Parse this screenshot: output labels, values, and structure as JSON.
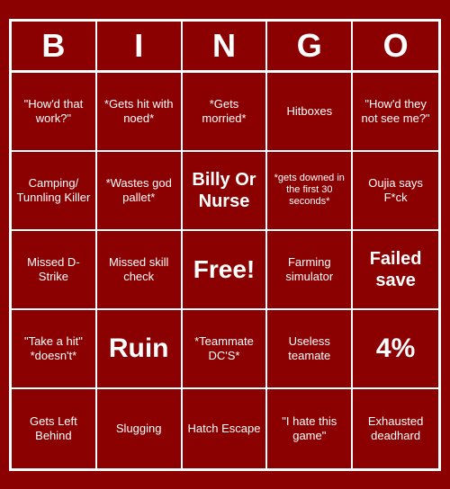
{
  "header": {
    "letters": [
      "B",
      "I",
      "N",
      "G",
      "O"
    ]
  },
  "cells": [
    {
      "text": "\"How'd that work?\"",
      "size": "normal"
    },
    {
      "text": "*Gets hit with noed*",
      "size": "normal"
    },
    {
      "text": "*Gets morried*",
      "size": "normal"
    },
    {
      "text": "Hitboxes",
      "size": "normal"
    },
    {
      "text": "\"How'd they not see me?\"",
      "size": "normal"
    },
    {
      "text": "Camping/ Tunnling Killer",
      "size": "normal"
    },
    {
      "text": "*Wastes god pallet*",
      "size": "normal"
    },
    {
      "text": "Billy Or Nurse",
      "size": "large"
    },
    {
      "text": "*gets downed in the first 30 seconds*",
      "size": "small"
    },
    {
      "text": "Oujia says F*ck",
      "size": "normal"
    },
    {
      "text": "Missed D-Strike",
      "size": "normal"
    },
    {
      "text": "Missed skill check",
      "size": "normal"
    },
    {
      "text": "Free!",
      "size": "free"
    },
    {
      "text": "Farming simulator",
      "size": "normal"
    },
    {
      "text": "Failed save",
      "size": "large"
    },
    {
      "text": "\"Take a hit\" *doesn't*",
      "size": "normal"
    },
    {
      "text": "Ruin",
      "size": "xl"
    },
    {
      "text": "*Teammate DC'S*",
      "size": "normal"
    },
    {
      "text": "Useless teamate",
      "size": "normal"
    },
    {
      "text": "4%",
      "size": "xl"
    },
    {
      "text": "Gets Left Behind",
      "size": "normal"
    },
    {
      "text": "Slugging",
      "size": "normal"
    },
    {
      "text": "Hatch Escape",
      "size": "normal"
    },
    {
      "text": "\"I hate this game\"",
      "size": "normal"
    },
    {
      "text": "Exhausted deadhard",
      "size": "normal"
    }
  ]
}
